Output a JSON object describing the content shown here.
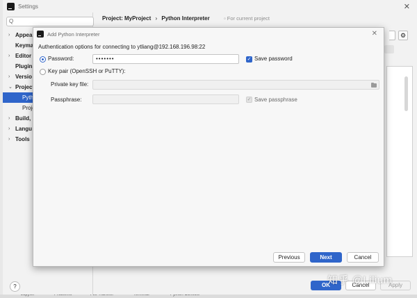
{
  "settings_window": {
    "title": "Settings",
    "search_placeholder": "",
    "tree": [
      {
        "label": "Appearance",
        "display": "Appear",
        "chevron": "›"
      },
      {
        "label": "Keymap",
        "display": "Keyma",
        "chevron": ""
      },
      {
        "label": "Editor",
        "display": "Editor",
        "chevron": "›"
      },
      {
        "label": "Plugins",
        "display": "Plugins",
        "chevron": ""
      },
      {
        "label": "Version Control",
        "display": "Versio",
        "chevron": "›"
      },
      {
        "label": "Project: MyProject",
        "display": "Project",
        "chevron": "⌄"
      },
      {
        "label": "Python Interpreter",
        "display": "Pyth",
        "child": true,
        "selected": true
      },
      {
        "label": "Project Structure",
        "display": "Proje",
        "child": true
      },
      {
        "label": "Build, Execution, Deployment",
        "display": "Build, E",
        "chevron": "›"
      },
      {
        "label": "Languages & Frameworks",
        "display": "Langu",
        "chevron": "›"
      },
      {
        "label": "Tools",
        "display": "Tools",
        "chevron": "›"
      }
    ],
    "breadcrumb_project": "Project: MyProject",
    "breadcrumb_separator": "›",
    "breadcrumb_page": "Python Interpreter",
    "for_current_project": "For current project",
    "help_label": "?",
    "ok_label": "OK",
    "cancel_label": "Cancel",
    "apply_label": "Apply"
  },
  "dialog": {
    "title": "Add Python Interpreter",
    "close_icon": "close-icon",
    "auth_text": "Authentication options for connecting to ytliang@192.168.196.98:22",
    "password_option": "Password:",
    "password_value": "•••••••",
    "password_selected": true,
    "save_password_label": "Save password",
    "save_password_checked": true,
    "keypair_option": "Key pair (OpenSSH or PuTTY):",
    "private_key_label": "Private key file:",
    "private_key_value": "",
    "passphrase_label": "Passphrase:",
    "passphrase_value": "",
    "save_passphrase_label": "Save passphrase",
    "save_passphrase_checked": true,
    "previous_label": "Previous",
    "next_label": "Next",
    "cancel_label": "Cancel"
  },
  "bottom_bar": [
    "Jupyter",
    "Problems",
    "File Transfer",
    "Terminal",
    "Python Console"
  ],
  "watermark": "知乎 @Lilium",
  "colors": {
    "accent": "#2f65ca",
    "window_bg": "#f2f2f2",
    "dialog_bg": "#f7f7f7"
  }
}
